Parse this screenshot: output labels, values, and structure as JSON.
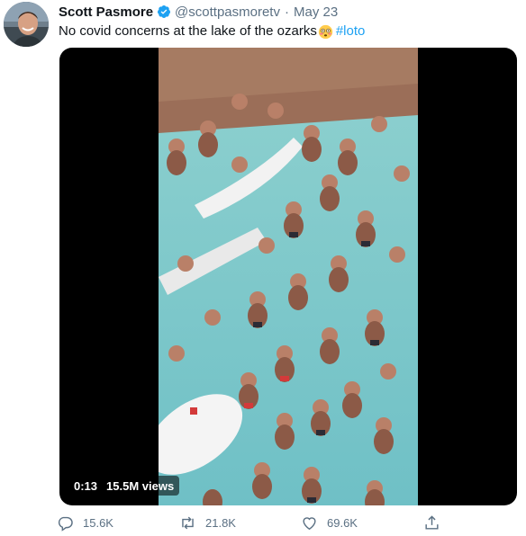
{
  "tweet": {
    "author": {
      "display_name": "Scott Pasmore",
      "handle": "@scottpasmoretv",
      "verified": true
    },
    "separator": "·",
    "date": "May 23",
    "text": "No covid concerns at the lake of the ozarks",
    "emoji": "flushed-face",
    "hashtag": "#loto"
  },
  "media": {
    "type": "video",
    "timestamp": "0:13",
    "views": "15.5M views",
    "description": "Aerial view of a crowded swimming pool with many people standing in turquoise water"
  },
  "actions": {
    "reply_count": "15.6K",
    "retweet_count": "21.8K",
    "like_count": "69.6K"
  },
  "colors": {
    "text": "#0f1419",
    "secondary": "#5b7083",
    "link": "#1da1f2",
    "pool": "#7fc8c9"
  }
}
